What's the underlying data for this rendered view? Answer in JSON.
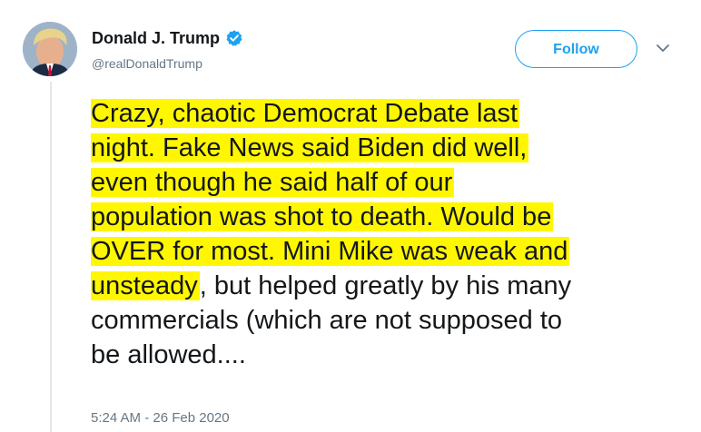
{
  "author": {
    "display_name": "Donald J. Trump",
    "handle": "@realDonaldTrump",
    "verified": true,
    "verified_icon": "verified-badge-icon",
    "avatar_icon": "profile-photo"
  },
  "actions": {
    "follow_label": "Follow",
    "more_icon": "chevron-down-icon"
  },
  "tweet": {
    "lines": [
      {
        "highlighted": "Crazy, chaotic Democrat Debate last",
        "plain": ""
      },
      {
        "highlighted": "night. Fake News said Biden did well,",
        "plain": ""
      },
      {
        "highlighted": "even though he said half of our",
        "plain": ""
      },
      {
        "highlighted": "population was shot to death. Would be",
        "plain": ""
      },
      {
        "highlighted": "OVER for most. Mini Mike was weak and",
        "plain": ""
      },
      {
        "highlighted": "unsteady",
        "plain": ", but helped greatly by his many"
      },
      {
        "highlighted": "",
        "plain": "commercials (which are not supposed to"
      },
      {
        "highlighted": "",
        "plain": "be allowed...."
      }
    ],
    "timestamp": "5:24 AM - 26 Feb 2020"
  },
  "colors": {
    "accent": "#1da1f2",
    "highlight": "#fff700",
    "text_primary": "#14171a",
    "text_secondary": "#657786"
  }
}
